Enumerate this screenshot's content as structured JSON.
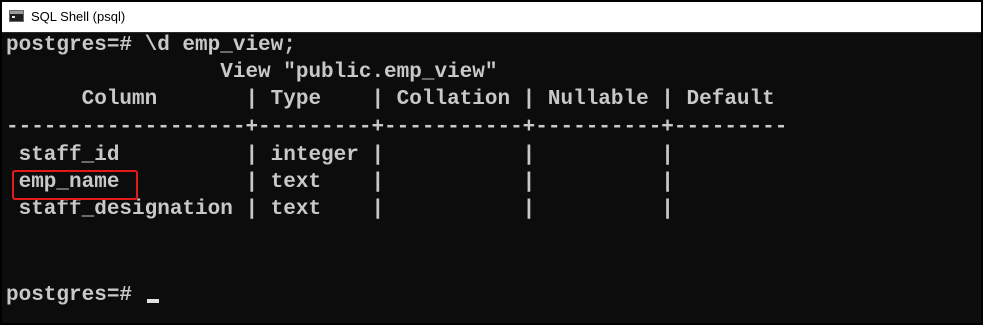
{
  "window": {
    "title": "SQL Shell (psql)"
  },
  "console": {
    "prompt_1": "postgres=# \\d emp_view;",
    "view_header": "                 View \"public.emp_view\"",
    "column_header": "      Column       | Type    | Collation | Nullable | Default",
    "separator": "-------------------+---------+-----------+----------+---------",
    "rows": [
      " staff_id          | integer |           |          |",
      " emp_name          | text    |           |          |",
      " staff_designation | text    |           |          |"
    ],
    "prompt_2": "postgres=# "
  },
  "colors": {
    "console_bg": "#0c0c0c",
    "console_fg": "#c8c8c8",
    "highlight_border": "#e21a1a"
  },
  "icons": {
    "app_icon": "terminal-icon"
  }
}
